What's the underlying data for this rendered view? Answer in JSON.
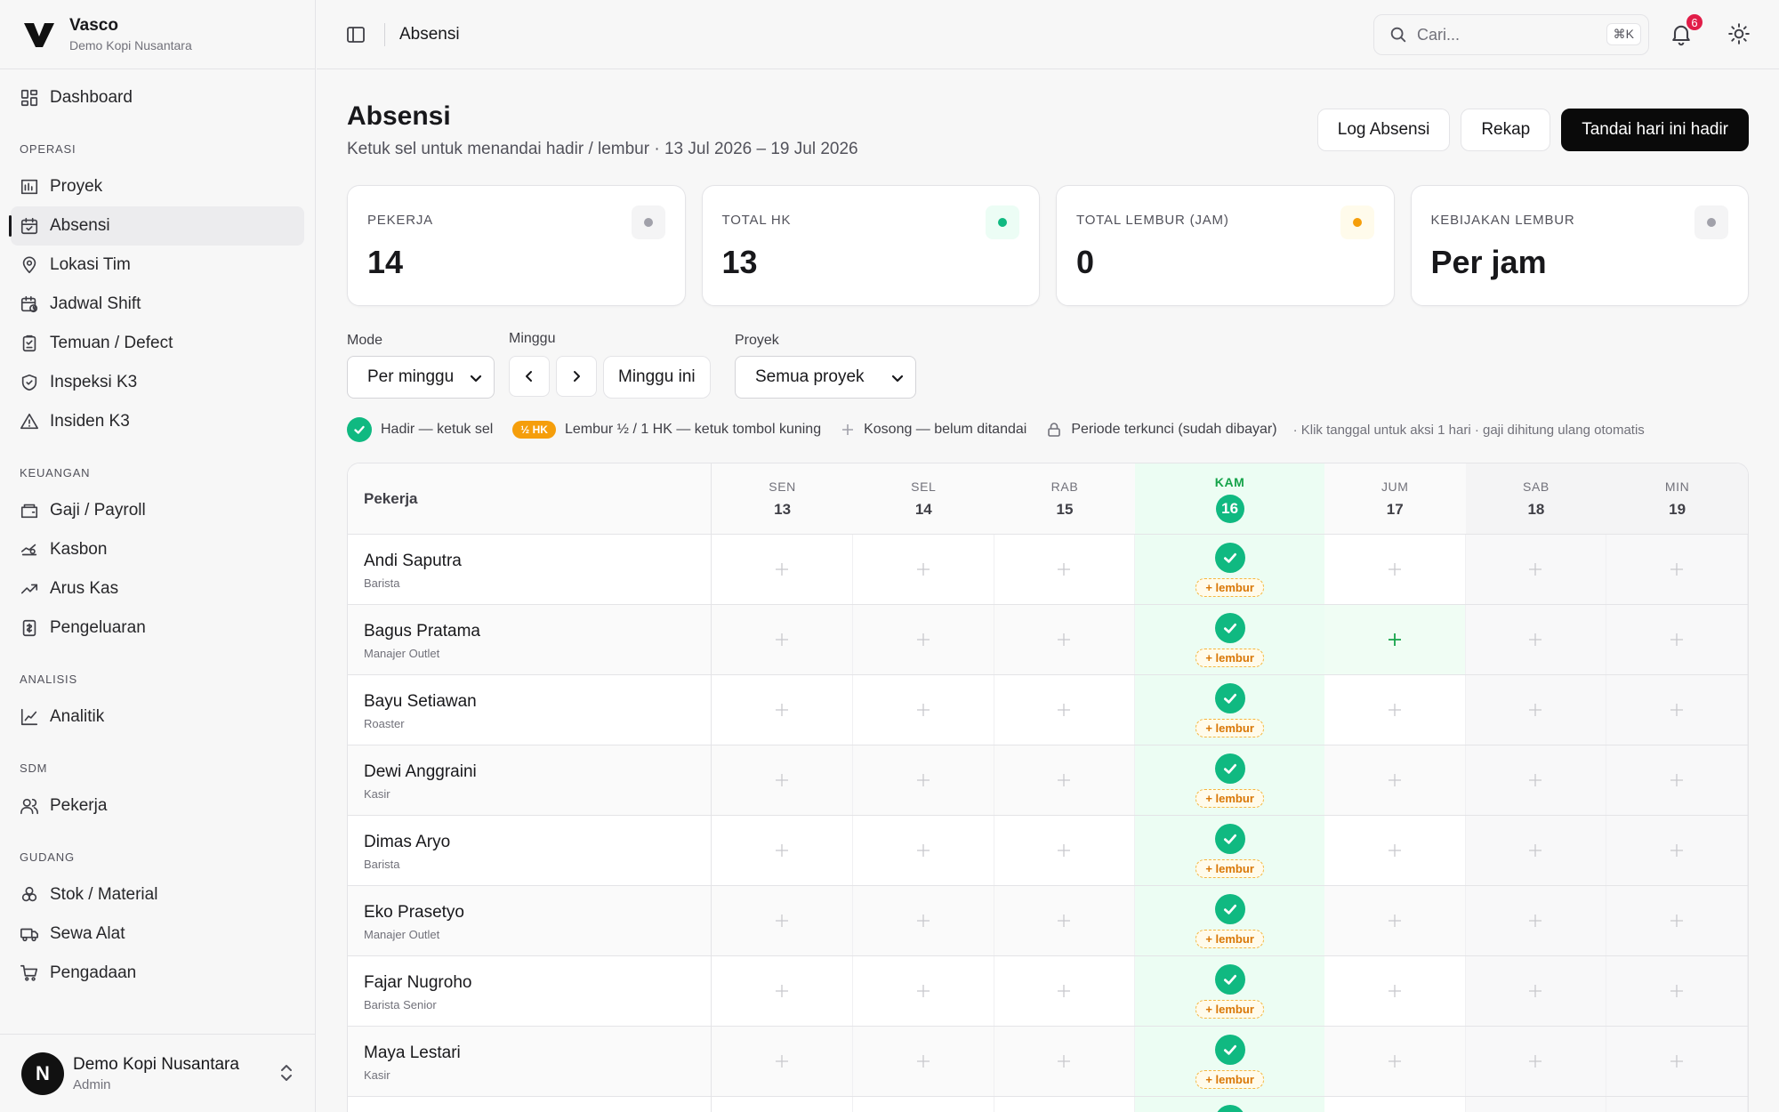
{
  "brand": {
    "name": "Vasco",
    "subtitle": "Demo Kopi Nusantara"
  },
  "sidebar": {
    "top_item": "Dashboard",
    "groups": [
      {
        "label": "OPERASI",
        "items": [
          "Proyek",
          "Absensi",
          "Lokasi Tim",
          "Jadwal Shift",
          "Temuan / Defect",
          "Inspeksi K3",
          "Insiden K3"
        ]
      },
      {
        "label": "KEUANGAN",
        "items": [
          "Gaji / Payroll",
          "Kasbon",
          "Arus Kas",
          "Pengeluaran"
        ]
      },
      {
        "label": "ANALISIS",
        "items": [
          "Analitik"
        ]
      },
      {
        "label": "SDM",
        "items": [
          "Pekerja"
        ]
      },
      {
        "label": "GUDANG",
        "items": [
          "Stok / Material",
          "Sewa Alat",
          "Pengadaan"
        ]
      }
    ],
    "active_item": "Absensi"
  },
  "user": {
    "initial": "N",
    "name": "Demo Kopi Nusantara",
    "role": "Admin"
  },
  "topbar": {
    "breadcrumb": "Absensi",
    "search_placeholder": "Cari...",
    "search_shortcut": "⌘K",
    "notification_count": "6"
  },
  "page": {
    "title": "Absensi",
    "subtitle": "Ketuk sel untuk menandai hadir / lembur · 13 Jul 2026 – 19 Jul 2026",
    "actions": {
      "log": "Log Absensi",
      "rekap": "Rekap",
      "mark_today": "Tandai hari ini hadir"
    }
  },
  "stats": [
    {
      "label": "PEKERJA",
      "value": "14",
      "dot_color": "#a1a1aa",
      "bg": "#f4f4f5"
    },
    {
      "label": "TOTAL HK",
      "value": "13",
      "dot_color": "#10b981",
      "bg": "#ecfdf5"
    },
    {
      "label": "TOTAL LEMBUR (JAM)",
      "value": "0",
      "dot_color": "#f59e0b",
      "bg": "#fffbeb"
    },
    {
      "label": "KEBIJAKAN LEMBUR",
      "value": "Per jam",
      "dot_color": "#a1a1aa",
      "bg": "#f4f4f5"
    }
  ],
  "filters": {
    "mode_label": "Mode",
    "mode_value": "Per minggu",
    "week_label": "Minggu",
    "this_week": "Minggu ini",
    "project_label": "Proyek",
    "project_value": "Semua proyek"
  },
  "legend": {
    "present": "Hadir — ketuk sel",
    "half_badge": "½ HK",
    "overtime": "Lembur ½ / 1 HK — ketuk tombol kuning",
    "empty": "Kosong — belum ditandai",
    "locked": "Periode terkunci (sudah dibayar)",
    "hint": "· Klik tanggal untuk aksi 1 hari · gaji dihitung ulang otomatis"
  },
  "table": {
    "worker_header": "Pekerja",
    "days": [
      {
        "dow": "SEN",
        "num": "13"
      },
      {
        "dow": "SEL",
        "num": "14"
      },
      {
        "dow": "RAB",
        "num": "15"
      },
      {
        "dow": "KAM",
        "num": "16",
        "today": true
      },
      {
        "dow": "JUM",
        "num": "17"
      },
      {
        "dow": "SAB",
        "num": "18",
        "weekend": true
      },
      {
        "dow": "MIN",
        "num": "19",
        "weekend": true
      }
    ],
    "lembur_label": "+ lembur",
    "rows": [
      {
        "name": "Andi Saputra",
        "role": "Barista"
      },
      {
        "name": "Bagus Pratama",
        "role": "Manajer Outlet",
        "highlight_fri": true
      },
      {
        "name": "Bayu Setiawan",
        "role": "Roaster"
      },
      {
        "name": "Dewi Anggraini",
        "role": "Kasir"
      },
      {
        "name": "Dimas Aryo",
        "role": "Barista"
      },
      {
        "name": "Eko Prasetyo",
        "role": "Manajer Outlet"
      },
      {
        "name": "Fajar Nugroho",
        "role": "Barista Senior"
      },
      {
        "name": "Maya Lestari",
        "role": "Kasir"
      },
      {
        "name": "",
        "role": ""
      }
    ]
  }
}
